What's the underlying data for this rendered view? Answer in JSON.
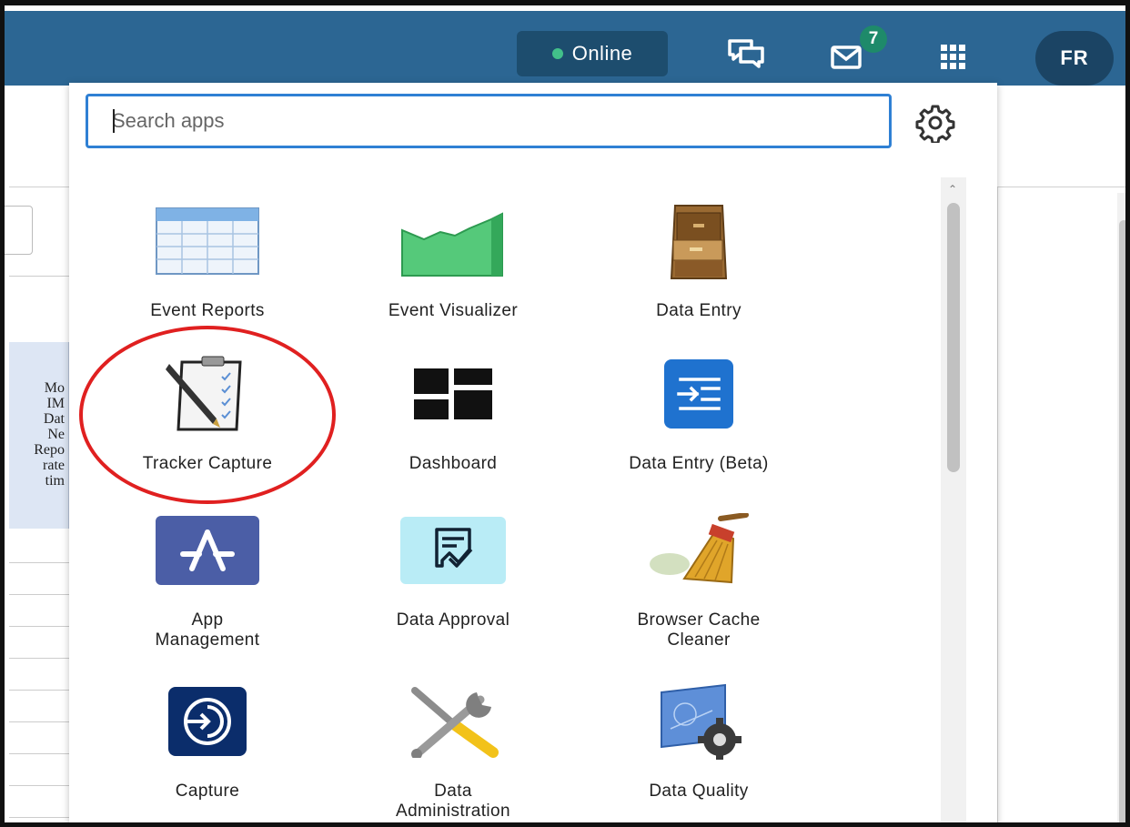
{
  "header": {
    "status_label": "Online",
    "messages_badge": "7",
    "user_initials": "FR"
  },
  "background_table": {
    "header_text": "Mo\nIM\nDat\nNe\nRepo\nrate\ntim"
  },
  "search": {
    "placeholder": "Search apps",
    "value": ""
  },
  "apps": [
    {
      "label": "Event Reports",
      "icon": "event-reports-icon"
    },
    {
      "label": "Event Visualizer",
      "icon": "event-visualizer-icon"
    },
    {
      "label": "Data Entry",
      "icon": "data-entry-icon"
    },
    {
      "label": "Tracker Capture",
      "icon": "tracker-capture-icon"
    },
    {
      "label": "Dashboard",
      "icon": "dashboard-icon"
    },
    {
      "label": "Data Entry (Beta)",
      "icon": "data-entry-beta-icon"
    },
    {
      "label": "App\nManagement",
      "icon": "app-management-icon"
    },
    {
      "label": "Data Approval",
      "icon": "data-approval-icon"
    },
    {
      "label": "Browser Cache\nCleaner",
      "icon": "browser-cache-cleaner-icon"
    },
    {
      "label": "Capture",
      "icon": "capture-icon"
    },
    {
      "label": "Data\nAdministration",
      "icon": "data-administration-icon"
    },
    {
      "label": "Data Quality",
      "icon": "data-quality-icon"
    }
  ],
  "colors": {
    "header": "#2c6693",
    "search_border": "#2f80d4",
    "highlight_circle": "#e02020"
  }
}
